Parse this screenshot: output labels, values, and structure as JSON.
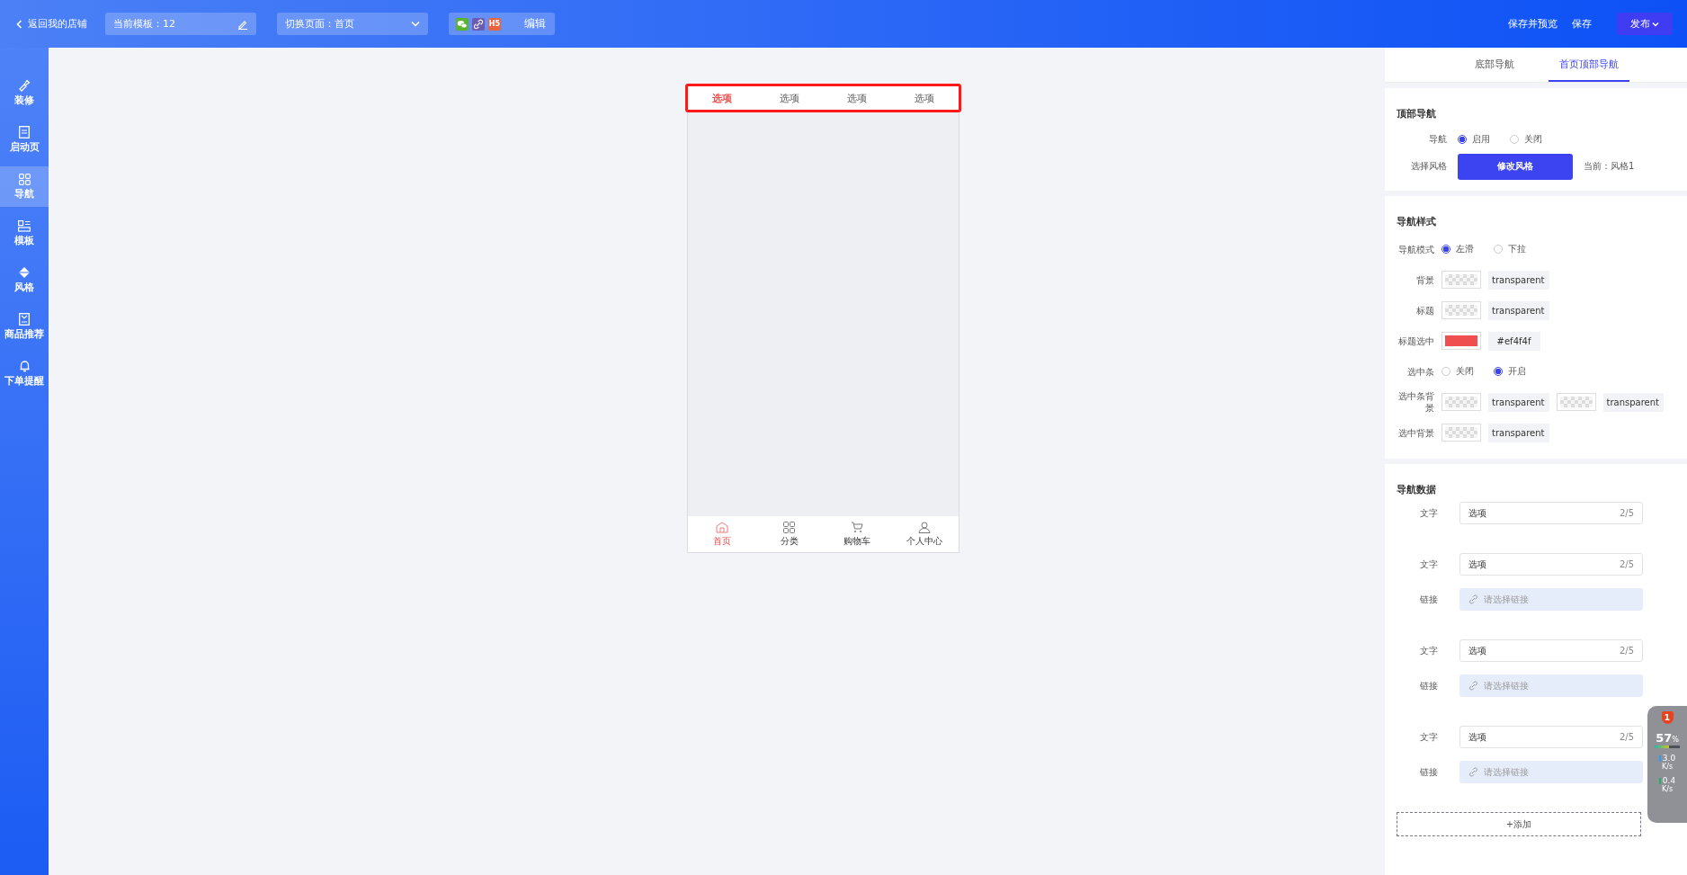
{
  "top_bar": {
    "back_link": "返回我的店铺",
    "template_field": "当前模板：12",
    "page_select": "切换页面：首页",
    "channel_badge": "H5",
    "edit_link": "编辑",
    "actions": [
      "保存并预览",
      "保存"
    ],
    "publish_button": "发布"
  },
  "sidebar": {
    "items": [
      {
        "label": "装修",
        "selected": false
      },
      {
        "label": "启动页",
        "selected": false
      },
      {
        "label": "导航",
        "selected": true
      },
      {
        "label": "模板",
        "selected": false
      },
      {
        "label": "风格",
        "selected": false
      },
      {
        "label": "商品推荐",
        "selected": false
      },
      {
        "label": "下单提醒",
        "selected": false
      }
    ]
  },
  "phone": {
    "top_tabs": [
      {
        "label": "选项",
        "selected": true
      },
      {
        "label": "选项",
        "selected": false
      },
      {
        "label": "选项",
        "selected": false
      },
      {
        "label": "选项",
        "selected": false
      }
    ],
    "bottom_tabs": [
      {
        "label": "首页",
        "selected": true
      },
      {
        "label": "分类",
        "selected": false
      },
      {
        "label": "购物车",
        "selected": false
      },
      {
        "label": "个人中心",
        "selected": false
      }
    ]
  },
  "panel": {
    "tabs": [
      {
        "label": "底部导航",
        "selected": false
      },
      {
        "label": "首页顶部导航",
        "selected": true
      }
    ],
    "top_nav": {
      "title": "顶部导航",
      "nav_label": "导航",
      "nav_options": [
        {
          "label": "启用",
          "selected": true
        },
        {
          "label": "关闭",
          "selected": false
        }
      ],
      "style_label": "选择风格",
      "style_button": "修改风格",
      "style_note": "当前：风格1"
    },
    "nav_style": {
      "title": "导航样式",
      "rows": [
        {
          "kind": "radio",
          "label": "导航模式",
          "options": [
            {
              "label": "左滑",
              "selected": true
            },
            {
              "label": "下拉",
              "selected": false
            }
          ]
        },
        {
          "kind": "colors",
          "label": "背景",
          "swatches": [
            {
              "value": "transparent"
            }
          ]
        },
        {
          "kind": "colors",
          "label": "标题",
          "swatches": [
            {
              "value": "transparent"
            }
          ]
        },
        {
          "kind": "colors",
          "label": "标题选中",
          "swatches": [
            {
              "value": "#ef4f4f",
              "color": "#ef4f4f"
            }
          ]
        },
        {
          "kind": "radio",
          "label": "选中条",
          "options": [
            {
              "label": "关闭",
              "selected": false
            },
            {
              "label": "开启",
              "selected": true
            }
          ]
        },
        {
          "kind": "colors",
          "label": "选中条背景",
          "swatches": [
            {
              "value": "transparent"
            },
            {
              "value": "transparent"
            }
          ]
        },
        {
          "kind": "colors",
          "label": "选中背景",
          "swatches": [
            {
              "value": "transparent"
            }
          ]
        }
      ]
    },
    "nav_data": {
      "title": "导航数据",
      "items": [
        {
          "text_label": "文字",
          "text_value": "选项",
          "counter": "2/5"
        },
        {
          "text_label": "文字",
          "text_value": "选项",
          "counter": "2/5",
          "link_label": "链接",
          "link_placeholder": "请选择链接"
        },
        {
          "text_label": "文字",
          "text_value": "选项",
          "counter": "2/5",
          "link_label": "链接",
          "link_placeholder": "请选择链接"
        },
        {
          "text_label": "文字",
          "text_value": "选项",
          "counter": "2/5",
          "link_label": "链接",
          "link_placeholder": "请选择链接"
        }
      ],
      "add_button": "+添加"
    }
  },
  "monitor": {
    "alert_count": "1",
    "percent": "57",
    "percent_unit": "%",
    "level": 0.57,
    "upload": "3.0",
    "upload_unit": "K/s",
    "download": "0.4",
    "download_unit": "K/s"
  }
}
